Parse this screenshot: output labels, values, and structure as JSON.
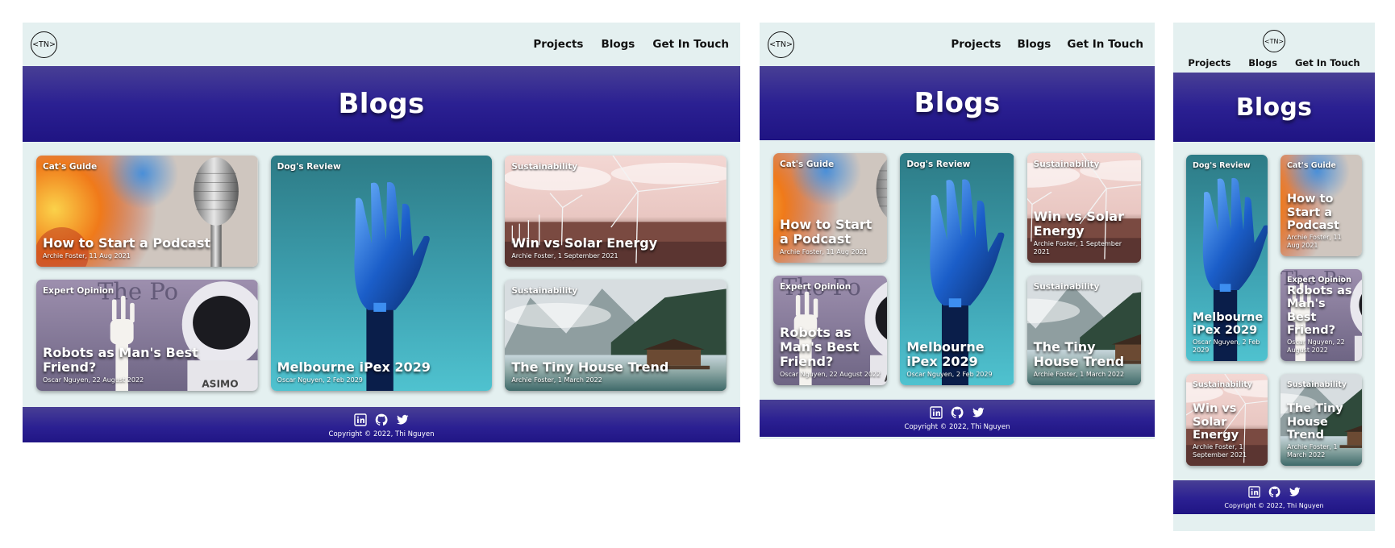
{
  "nav": {
    "logo_text": "<TN>",
    "links": [
      "Projects",
      "Blogs",
      "Get In Touch"
    ]
  },
  "hero": {
    "title": "Blogs"
  },
  "posts": {
    "podcast": {
      "category": "Cat's Guide",
      "title": "How to Start a Podcast",
      "meta": "Archie Foster, 11 Aug 2021"
    },
    "robots": {
      "category": "Expert Opinion",
      "title": "Robots as Man's Best Friend?",
      "meta": "Oscar Nguyen, 22 August 2022"
    },
    "ipex": {
      "category": "Dog's Review",
      "title": "Melbourne iPex 2029",
      "meta": "Oscar Nguyen, 2 Feb 2029"
    },
    "winvs": {
      "category": "Sustainability",
      "title": "Win vs Solar Energy",
      "meta": "Archie Foster, 1 September 2021"
    },
    "tinyhouse": {
      "category": "Sustainability",
      "title": "The Tiny House Trend",
      "meta": "Archie Foster, 1 March 2022"
    }
  },
  "footer": {
    "social": [
      "linkedin-icon",
      "github-icon",
      "twitter-icon"
    ],
    "copyright": "Copyright © 2022, Thi Nguyen"
  },
  "colors": {
    "page_bg": "#e4f0f0",
    "hero_gradient_top": "#483f95",
    "hero_gradient_bottom": "#1f1483"
  }
}
